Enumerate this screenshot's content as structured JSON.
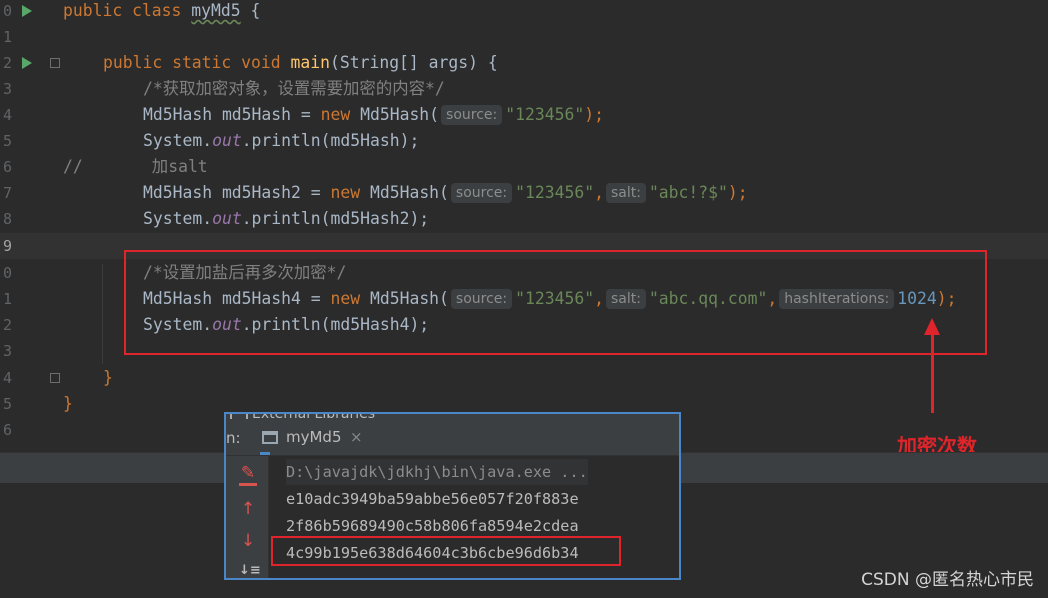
{
  "editor": {
    "line_numbers": [
      "0",
      "1",
      "2",
      "3",
      "4",
      "5",
      "6",
      "7",
      "8",
      "9",
      "0",
      "1",
      "2",
      "3",
      "4",
      "5",
      "6"
    ],
    "l0": {
      "kw": "public class ",
      "name": "myMd5",
      "rest": " {"
    },
    "l2": {
      "kw": "public static void ",
      "fn": "main",
      "rest": "(String[] args) {"
    },
    "l3": {
      "comment": "/*获取加密对象，设置需要加密的内容*/"
    },
    "l4": {
      "a": "Md5Hash md5Hash = ",
      "kw": "new",
      "b": " Md5Hash(",
      "hint1": "source:",
      "str1": "\"123456\"",
      "end": ");"
    },
    "l5": {
      "a": "System.",
      "static": "out",
      "b": ".println(md5Hash);"
    },
    "l6": {
      "comment": "//       加salt"
    },
    "l7": {
      "a": "Md5Hash md5Hash2 = ",
      "kw": "new",
      "b": " Md5Hash(",
      "hint1": "source:",
      "str1": "\"123456\"",
      "comma": ",",
      "hint2": "salt:",
      "str2": "\"abc!?$\"",
      "end": ");"
    },
    "l8": {
      "a": "System.",
      "static": "out",
      "b": ".println(md5Hash2);"
    },
    "l10": {
      "comment": "/*设置加盐后再多次加密*/"
    },
    "l11": {
      "a": "Md5Hash md5Hash4 = ",
      "kw": "new",
      "b": " Md5Hash(",
      "hint1": "source:",
      "str1": "\"123456\"",
      "comma1": ",",
      "hint2": "salt:",
      "str2": "\"abc.qq.com\"",
      "comma2": ",",
      "hint3": "hashIterations:",
      "num": "1024",
      "end": ");"
    },
    "l12": {
      "a": "System.",
      "static": "out",
      "b": ".println(md5Hash4);"
    },
    "l14": {
      "text": "}"
    },
    "l15": {
      "text": "}"
    }
  },
  "annotation": "加密次数",
  "popup": {
    "peek_title": "External Libraries",
    "run_label": "n:",
    "tab_label": "myMd5",
    "tab_close": "×",
    "toolbar": {
      "edit": "✎",
      "up": "↑",
      "down": "↓",
      "sort": "↓≡"
    },
    "console_lines": [
      "D:\\javajdk\\jdkhj\\bin\\java.exe ...",
      "e10adc3949ba59abbe56e057f20f883e",
      "2f86b59689490c58b806fa8594e2cdea",
      "4c99b195e638d64604c3b6cbe96d6b34"
    ]
  },
  "watermark": "CSDN @匿名热心市民",
  "colors": {
    "highlight_red": "#e0242b",
    "keyword": "#cc7832",
    "string": "#6a8759",
    "number": "#6897bb"
  }
}
